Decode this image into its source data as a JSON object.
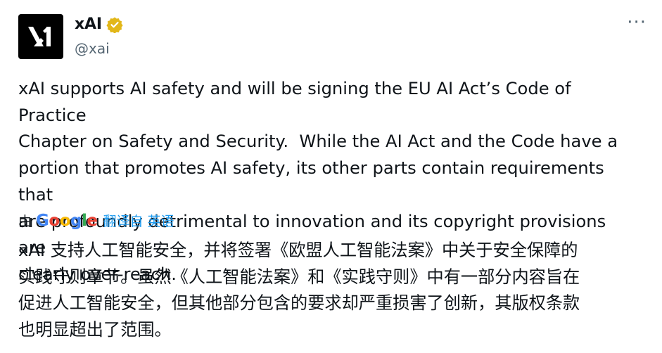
{
  "author": {
    "display_name": "xAI",
    "handle": "@xai",
    "verified": true,
    "verified_color": "#e2b719"
  },
  "menu": {
    "more_label": "···"
  },
  "tweet": {
    "text": "xAI supports AI safety and will be signing the EU AI Act’s Code of Practice\nChapter on Safety and Security.  While the AI Act and the Code have a\nportion that promotes AI safety, its other parts contain requirements that\nare profoundly detrimental to innovation and its copyright provisions are\nclearly over-reach."
  },
  "translation": {
    "by_label": "由",
    "provider": "Google",
    "provider_colors": [
      "#4285f4",
      "#ea4335",
      "#fbbc05",
      "#4285f4",
      "#34a853",
      "#ea4335"
    ],
    "link_label": "翻译自 英语",
    "text": "xAI 支持人工智能安全，并将签署《欧盟人工智能法案》中关于安全保障的\n实践守则章节。虽然《人工智能法案》和《实践守则》中有一部分内容旨在\n促进人工智能安全，但其他部分包含的要求却严重损害了创新，其版权条款\n也明显超出了范围。"
  }
}
